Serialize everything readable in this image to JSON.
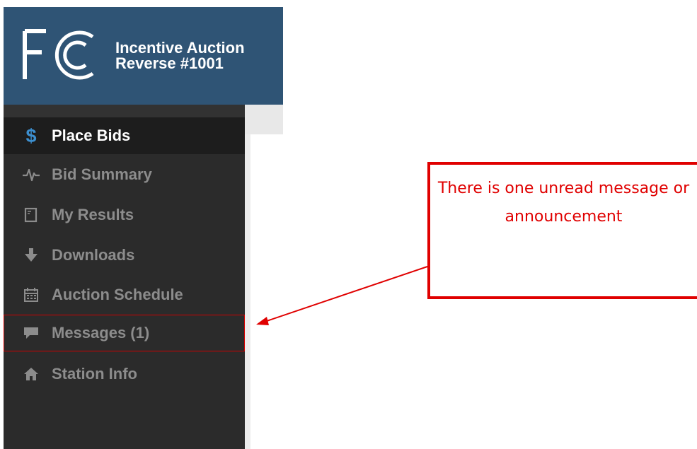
{
  "header": {
    "logo_text": "FCC",
    "title_line1": "Incentive Auction",
    "title_line2": "Reverse #1001"
  },
  "sidebar": {
    "items": [
      {
        "label": "Place Bids",
        "icon": "dollar-icon",
        "active": true
      },
      {
        "label": "Bid Summary",
        "icon": "pulse-icon"
      },
      {
        "label": "My Results",
        "icon": "document-icon"
      },
      {
        "label": "Downloads",
        "icon": "arrow-down-icon"
      },
      {
        "label": "Auction Schedule",
        "icon": "calendar-icon"
      },
      {
        "label": "Messages (1)",
        "icon": "chat-icon",
        "highlighted": true
      },
      {
        "label": "Station Info",
        "icon": "home-icon"
      }
    ]
  },
  "annotation": {
    "text": "There is one unread message or announcement",
    "color": "#e00000"
  },
  "colors": {
    "header_bg": "#2f5475",
    "sidebar_bg": "#2b2b2b",
    "active_bg": "#1d1d1d",
    "accent": "#3c8fcf",
    "inactive_text": "#8c8c8c"
  }
}
